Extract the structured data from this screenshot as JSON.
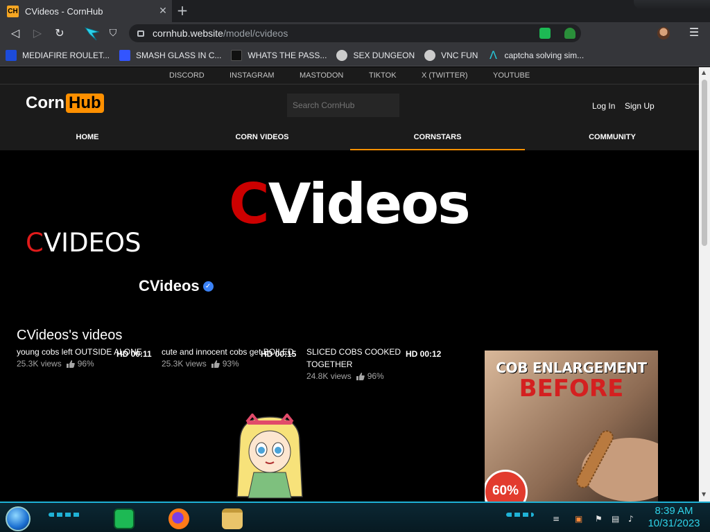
{
  "browser": {
    "tab_title": "CVideos - CornHub",
    "favicon_text": "CH",
    "url_host": "cornhub.website",
    "url_path": "/model/cvideos"
  },
  "bookmarks": [
    {
      "label": "MEDIAFIRE ROULET...",
      "icon_color": "#1c4bd9"
    },
    {
      "label": "SMASH GLASS IN C...",
      "icon_color": "#3355ff"
    },
    {
      "label": "WHATS THE PASS...",
      "icon_color": "#111111"
    },
    {
      "label": "SEX DUNGEON",
      "icon_color": "#cccccc"
    },
    {
      "label": "VNC FUN",
      "icon_color": "#cccccc"
    },
    {
      "label": "captcha solving sim...",
      "icon_color": "#27c7d8"
    }
  ],
  "social_links": [
    "DISCORD",
    "INSTAGRAM",
    "MASTODON",
    "TIKTOK",
    "X (TWITTER)",
    "YOUTUBE"
  ],
  "site": {
    "logo_left": "Corn",
    "logo_right": "Hub",
    "search_placeholder": "Search CornHub",
    "login": "Log In",
    "signup": "Sign Up",
    "accent": "#ff9000"
  },
  "nav": [
    "HOME",
    "CORN VIDEOS",
    "CORNSTARS",
    "COMMUNITY"
  ],
  "cover": {
    "title_first": "C",
    "title_rest": "Videos"
  },
  "side_title": {
    "first": "C",
    "rest": "VIDEOS"
  },
  "model": {
    "name": "CVideos",
    "verified_mark": "✓"
  },
  "videos_heading": "CVideos's videos",
  "videos": [
    {
      "title": "young cobs left OUTSIDE ALONE",
      "views": "25.3K views",
      "rating": "96%",
      "duration": "HD 00:11"
    },
    {
      "title": "cute and innocent cobs get BOILED",
      "views": "25.3K views",
      "rating": "93%",
      "duration": "HD 00:15"
    },
    {
      "title": "SLICED COBS COOKED TOGETHER",
      "views": "24.8K views",
      "rating": "96%",
      "duration": "HD 00:12"
    }
  ],
  "ad": {
    "headline": "COB ENLARGEMENT",
    "sub": "BEFORE",
    "badge": "60%"
  },
  "taskbar": {
    "time": "8:39 AM",
    "date": "10/31/2023"
  }
}
